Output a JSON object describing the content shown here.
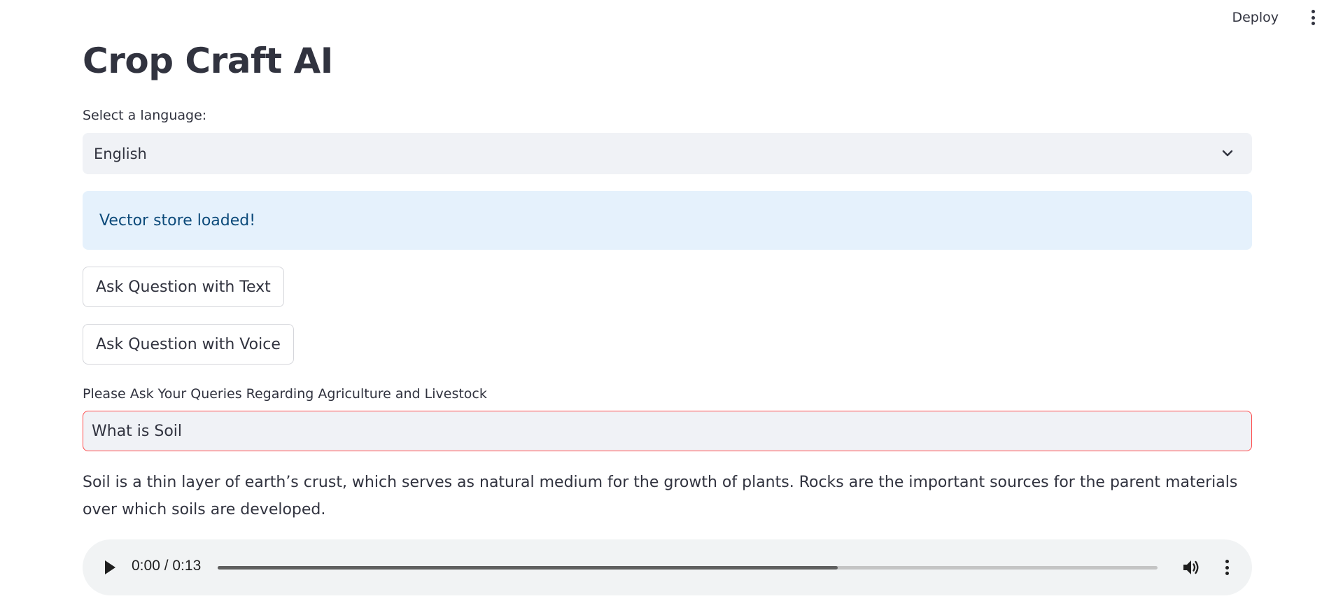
{
  "header": {
    "deploy_label": "Deploy",
    "menu_icon": "kebab-menu-icon"
  },
  "main": {
    "title": "Crop Craft AI",
    "language": {
      "label": "Select a language:",
      "selected": "English",
      "icon": "chevron-down-icon"
    },
    "info_message": "Vector store loaded!",
    "buttons": {
      "ask_text": "Ask Question with Text",
      "ask_voice": "Ask Question with Voice"
    },
    "query": {
      "label": "Please Ask Your Queries Regarding Agriculture and Livestock",
      "value": "What is Soil"
    },
    "answer": "Soil is a thin layer of earth’s crust, which serves as natural medium for the growth of plants. Rocks are the important sources for the parent materials over which soils are developed.",
    "audio": {
      "time": "0:00 / 0:13",
      "buffered_fraction": 0.66,
      "play_icon": "play-icon",
      "volume_icon": "volume-icon",
      "menu_icon": "kebab-menu-icon"
    }
  },
  "colors": {
    "accent_error_border": "#ff4b4b",
    "info_bg": "#e5f1fc",
    "info_text": "#0c4a7a",
    "input_bg": "#f0f2f6"
  }
}
